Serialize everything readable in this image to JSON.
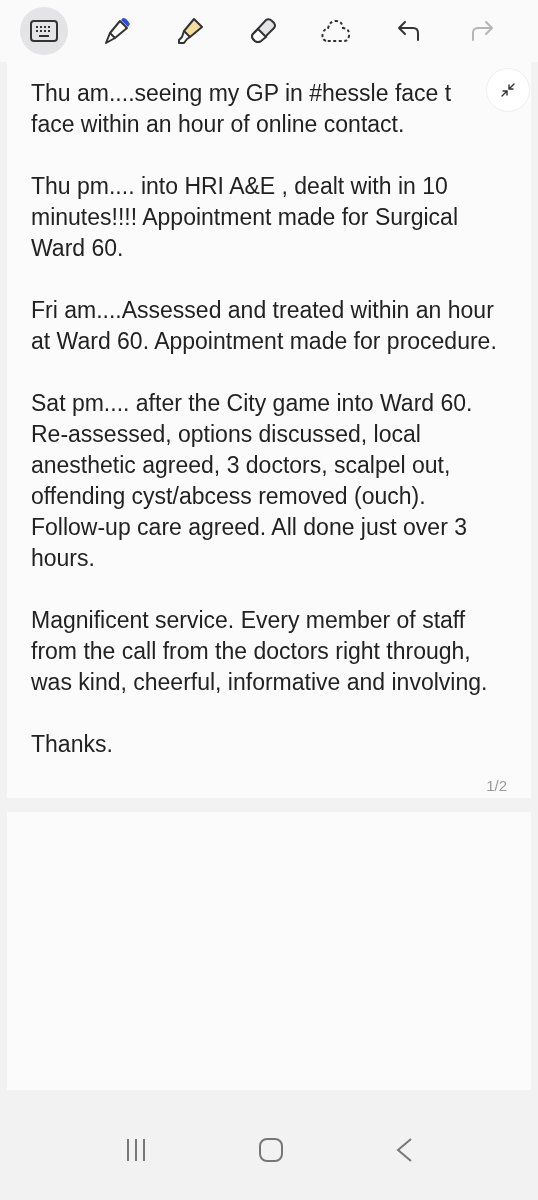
{
  "toolbar": [
    {
      "kind": "keyboard",
      "selected": true,
      "disabled": false
    },
    {
      "kind": "pen",
      "selected": false,
      "disabled": false
    },
    {
      "kind": "highlighter",
      "selected": false,
      "disabled": false
    },
    {
      "kind": "eraser",
      "selected": false,
      "disabled": false
    },
    {
      "kind": "lasso",
      "selected": false,
      "disabled": false
    },
    {
      "kind": "undo",
      "selected": false,
      "disabled": false
    },
    {
      "kind": "redo",
      "selected": false,
      "disabled": true
    }
  ],
  "page": {
    "paragraphs": [
      "Thu am....seeing my GP in #hessle face t\nface within an hour of online contact.",
      "Thu pm.... into HRI A&E , dealt with in 10\nminutes!!!! Appointment made for Surgical\nWard 60.",
      "Fri am....Assessed and treated within an hour\nat Ward 60. Appointment made for procedure.",
      "Sat pm.... after the City game into Ward 60.\nRe-assessed, options discussed, local\nanesthetic agreed, 3 doctors, scalpel out,\noffending cyst/abcess removed (ouch).\nFollow-up care agreed. All done just over 3\nhours.",
      "Magnificent service. Every member of staff\nfrom the call from the doctors right through,\nwas kind, cheerful, informative and involving.",
      "Thanks."
    ],
    "page_number": "1/2"
  },
  "nav_bar": [
    {
      "kind": "recents"
    },
    {
      "kind": "home"
    },
    {
      "kind": "back"
    }
  ]
}
